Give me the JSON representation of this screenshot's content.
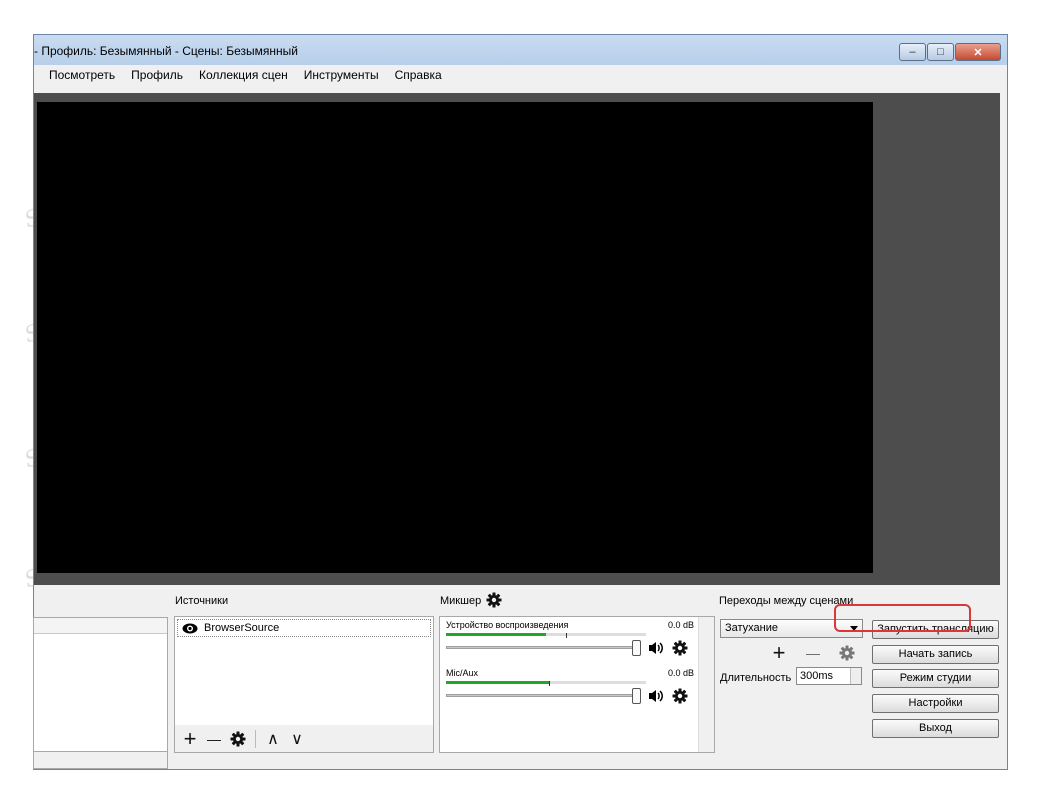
{
  "window": {
    "title": "- Профиль: Безымянный - Сцены: Безымянный",
    "controls": {
      "minimize": "‒",
      "maximize": "□",
      "close": "✕"
    }
  },
  "menu": {
    "items": [
      "Посмотреть",
      "Профиль",
      "Коллекция сцен",
      "Инструменты",
      "Справка"
    ]
  },
  "sources": {
    "label": "Источники",
    "items": [
      {
        "name": "BrowserSource"
      }
    ],
    "toolbar": {
      "add": "+",
      "remove": "—",
      "up": "∧",
      "down": "∨"
    }
  },
  "mixer": {
    "label": "Микшер",
    "tracks": [
      {
        "name": "Устройство воспроизведения",
        "db": "0.0 dB",
        "level": 0.5
      },
      {
        "name": "Mic/Aux",
        "db": "0.0 dB",
        "level": 0.52
      }
    ]
  },
  "transitions": {
    "label": "Переходы между сценами",
    "selected": "Затухание",
    "duration_label": "Длительность",
    "duration_value": "300ms",
    "add": "+",
    "remove": "—"
  },
  "controls": {
    "start_stream": "Запустить трансляцию",
    "start_record": "Начать запись",
    "studio_mode": "Режим студии",
    "settings": "Настройки",
    "exit": "Выход"
  },
  "watermark": {
    "text": "Soringpcrepair.com"
  },
  "colors": {
    "highlight": "#d9373a",
    "meter": "#1fa82a",
    "preview": "#000000"
  }
}
